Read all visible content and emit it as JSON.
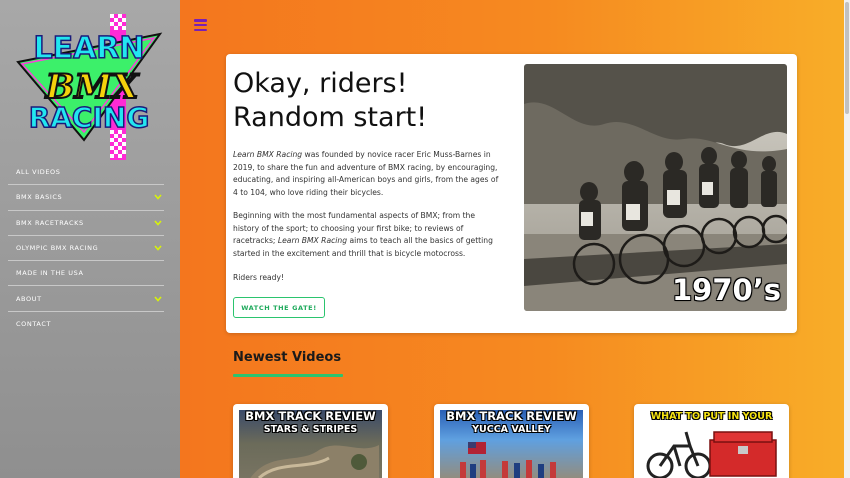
{
  "logo": {
    "line1": "LEARN",
    "line2": "BMX",
    "line3": "RACING"
  },
  "nav": {
    "items": [
      {
        "label": "ALL VIDEOS",
        "has_submenu": false
      },
      {
        "label": "BMX BASICS",
        "has_submenu": true
      },
      {
        "label": "BMX RACETRACKS",
        "has_submenu": true
      },
      {
        "label": "OLYMPIC BMX RACING",
        "has_submenu": true
      },
      {
        "label": "MADE IN THE USA",
        "has_submenu": false
      },
      {
        "label": "ABOUT",
        "has_submenu": true
      },
      {
        "label": "CONTACT",
        "has_submenu": false
      }
    ]
  },
  "hero": {
    "title_line1": "Okay, riders!",
    "title_line2": "Random start!",
    "p1_brand": "Learn BMX Racing",
    "p1_text": " was founded by novice racer Eric Muss-Barnes in 2019, to share the fun and adventure of BMX racing, by encouraging, educating, and inspiring all-American boys and girls, from the ages of 4 to 104, who love riding their bicycles.",
    "p2_text_a": "Beginning with the most fundamental aspects of BMX; from the history of the sport; to choosing your first bike; to reviews of racetracks; ",
    "p2_brand": "Learn BMX Racing",
    "p2_text_b": " aims to teach all the basics of getting started in the excitement and thrill that is bicycle motocross.",
    "p3_text": "Riders ready!",
    "button_label": "WATCH THE GATE!",
    "photo_caption": "1970’s"
  },
  "newest": {
    "heading": "Newest Videos",
    "videos": [
      {
        "title": "BMX TRACK REVIEW",
        "subtitle": "STARS & STRIPES"
      },
      {
        "title": "BMX TRACK REVIEW",
        "subtitle": "YUCCA VALLEY"
      },
      {
        "title": "WHAT TO PUT IN YOUR",
        "subtitle": ""
      }
    ]
  },
  "colors": {
    "accent_green": "#2bc46e",
    "menu_purple": "#7a1fb4",
    "chevron_yellow": "#d7f20a"
  }
}
